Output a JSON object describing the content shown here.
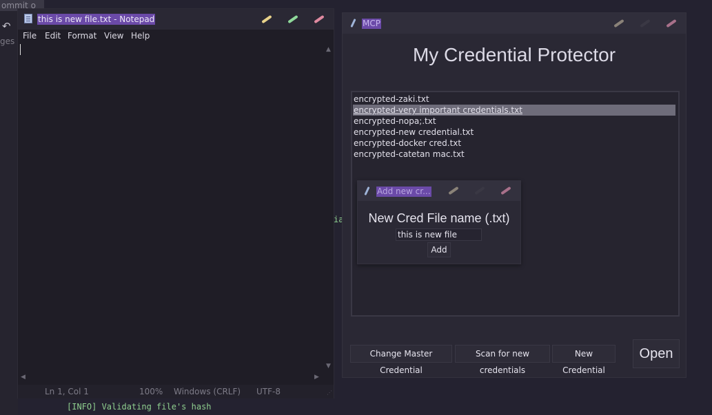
{
  "background": {
    "commit_text": "ommit o",
    "undo_icon": "undo-icon",
    "side_text": "ges",
    "fragment_text": "ia",
    "log_line": "[INFO] Validating file's hash"
  },
  "notepad": {
    "title": "this is new file.txt - Notepad",
    "menu": [
      "File",
      "Edit",
      "Format",
      "View",
      "Help"
    ],
    "status": {
      "position": "Ln 1, Col 1",
      "zoom": "100%",
      "line_ending": "Windows (CRLF)",
      "encoding": "UTF-8"
    },
    "colors": {
      "minimize": "#e8d28a",
      "maximize": "#8fd89a",
      "close": "#e08aa0"
    }
  },
  "mcp": {
    "title": "MCP",
    "heading": "My Credential Protector",
    "files": [
      "encrypted-zaki.txt",
      "encrypted-very important credentials.txt",
      "encrypted-nopa;.txt",
      "encrypted-new credential.txt",
      "encrypted-docker cred.txt",
      "encrypted-catetan mac.txt"
    ],
    "selected_index": 1,
    "buttons": {
      "change_master": "Change Master Credential",
      "scan": "Scan for new credentials",
      "new_credential": "New Credential",
      "open": "Open"
    },
    "colors": {
      "minimize": "#8a8278",
      "maximize": "#3a3844",
      "close": "#a8708a"
    }
  },
  "dialog": {
    "title": "Add new cr...",
    "heading": "New Cred File name (.txt)",
    "input_value": "this is new file",
    "add_label": "Add"
  }
}
